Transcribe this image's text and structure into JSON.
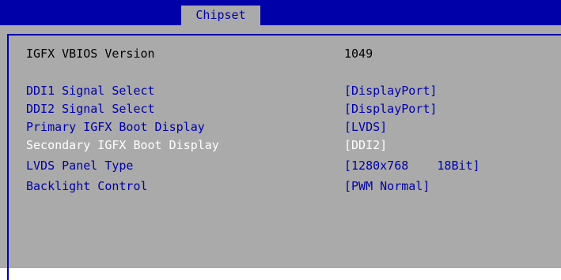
{
  "header": {
    "active_tab": "Chipset"
  },
  "colors": {
    "header_bg": "#0000a8",
    "panel_bg": "#aaaaaa",
    "item_text": "#0000a8",
    "info_text": "#000000",
    "disabled_text": "#ffffff"
  },
  "info": {
    "vbios_label": "IGFX VBIOS Version",
    "vbios_value": "1049"
  },
  "settings": [
    {
      "label": "DDI1 Signal Select",
      "value": "[DisplayPort]",
      "state": "enabled"
    },
    {
      "label": "DDI2 Signal Select",
      "value": "[DisplayPort]",
      "state": "enabled"
    },
    {
      "label": "Primary IGFX Boot Display",
      "value": "[LVDS]",
      "state": "enabled"
    },
    {
      "label": "Secondary IGFX Boot Display",
      "value": "[DDI2]",
      "state": "disabled"
    },
    {
      "label": "LVDS Panel Type",
      "value": "[1280x768    18Bit]",
      "state": "enabled"
    },
    {
      "label": "Backlight Control",
      "value": "[PWM Normal]",
      "state": "enabled"
    }
  ]
}
